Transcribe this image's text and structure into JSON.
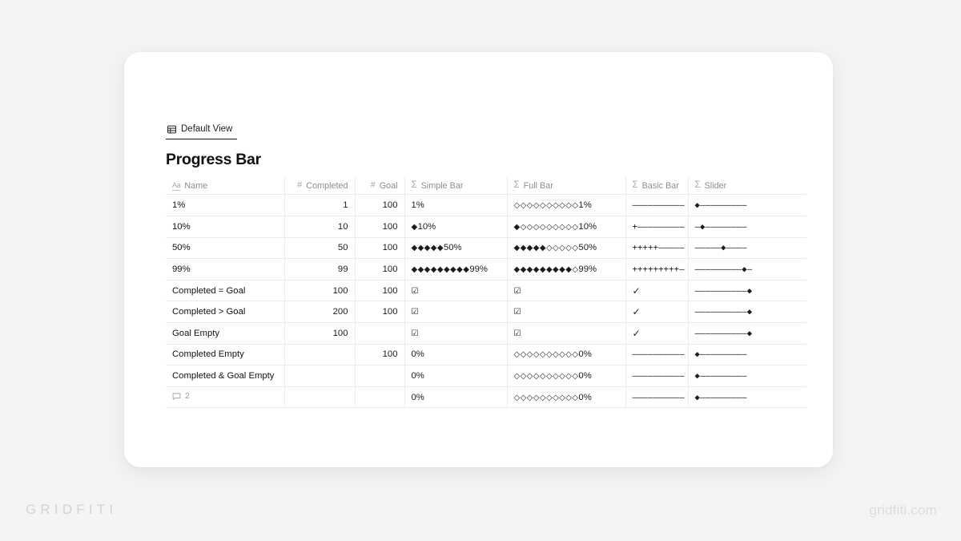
{
  "view_tab": {
    "label": "Default View",
    "icon": "table-grid-icon"
  },
  "page_title": "Progress Bar",
  "table": {
    "columns": [
      {
        "label": "Name",
        "icon": "text-aa-icon",
        "type": "title"
      },
      {
        "label": "Completed",
        "icon": "number-hash-icon",
        "type": "number"
      },
      {
        "label": "Goal",
        "icon": "number-hash-icon",
        "type": "number"
      },
      {
        "label": "Simple Bar",
        "icon": "formula-sigma-icon",
        "type": "formula"
      },
      {
        "label": "Full Bar",
        "icon": "formula-sigma-icon",
        "type": "formula"
      },
      {
        "label": "Basic Bar",
        "icon": "formula-sigma-icon",
        "type": "formula"
      },
      {
        "label": "Slider",
        "icon": "formula-sigma-icon",
        "type": "formula"
      }
    ],
    "rows": [
      {
        "name": "1%",
        "completed": "1",
        "goal": "100",
        "simple_bar": "",
        "simple_pct": "1%",
        "full_bar": "◇◇◇◇◇◇◇◇◇◇",
        "full_pct": "1%",
        "basic_bar": "––––––––––",
        "slider": "◆–––––––––"
      },
      {
        "name": "10%",
        "completed": "10",
        "goal": "100",
        "simple_bar": "◆",
        "simple_pct": "10%",
        "full_bar": "◆◇◇◇◇◇◇◇◇◇",
        "full_pct": "10%",
        "basic_bar": "+–––––––––",
        "slider": "–◆––––––––"
      },
      {
        "name": "50%",
        "completed": "50",
        "goal": "100",
        "simple_bar": "◆◆◆◆◆",
        "simple_pct": "50%",
        "full_bar": "◆◆◆◆◆◇◇◇◇◇",
        "full_pct": "50%",
        "basic_bar": "+++++–––––",
        "slider": "–––––◆––––"
      },
      {
        "name": "99%",
        "completed": "99",
        "goal": "100",
        "simple_bar": "◆◆◆◆◆◆◆◆◆",
        "simple_pct": "99%",
        "full_bar": "◆◆◆◆◆◆◆◆◆◇",
        "full_pct": "99%",
        "basic_bar": "+++++++++–",
        "slider": "–––––––––◆–"
      },
      {
        "name": "Completed = Goal",
        "completed": "100",
        "goal": "100",
        "simple_bar": "☑",
        "simple_pct": "",
        "full_bar": "☑",
        "full_pct": "",
        "basic_bar": "✓",
        "slider": "––––––––––◆"
      },
      {
        "name": "Completed > Goal",
        "completed": "200",
        "goal": "100",
        "simple_bar": "☑",
        "simple_pct": "",
        "full_bar": "☑",
        "full_pct": "",
        "basic_bar": "✓",
        "slider": "––––––––––◆"
      },
      {
        "name": "Goal Empty",
        "completed": "100",
        "goal": "",
        "simple_bar": "☑",
        "simple_pct": "",
        "full_bar": "☑",
        "full_pct": "",
        "basic_bar": "✓",
        "slider": "––––––––––◆"
      },
      {
        "name": "Completed Empty",
        "completed": "",
        "goal": "100",
        "simple_bar": "",
        "simple_pct": "0%",
        "full_bar": "◇◇◇◇◇◇◇◇◇◇",
        "full_pct": "0%",
        "basic_bar": "––––––––––",
        "slider": "◆–––––––––"
      },
      {
        "name": "Completed & Goal Empty",
        "completed": "",
        "goal": "",
        "simple_bar": "",
        "simple_pct": "0%",
        "full_bar": "◇◇◇◇◇◇◇◇◇◇",
        "full_pct": "0%",
        "basic_bar": "––––––––––",
        "slider": "◆–––––––––"
      },
      {
        "name": "",
        "is_comment_row": true,
        "comment_count": "2",
        "completed": "",
        "goal": "",
        "simple_bar": "",
        "simple_pct": "0%",
        "full_bar": "◇◇◇◇◇◇◇◇◇◇",
        "full_pct": "0%",
        "basic_bar": "––––––––––",
        "slider": "◆–––––––––"
      }
    ]
  },
  "branding": {
    "left": "GRIDFITI",
    "right": "gridfiti.com"
  }
}
